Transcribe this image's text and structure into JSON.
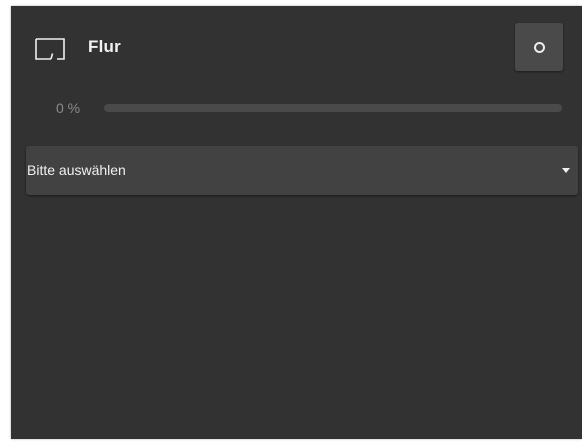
{
  "room": {
    "title": "Flur",
    "icon": "room-outline-icon"
  },
  "action_button": {
    "icon": "circle-icon"
  },
  "progress": {
    "label": "0 %",
    "value": 0
  },
  "select": {
    "selected": "Bitte auswählen",
    "caret_icon": "caret-down-icon"
  },
  "colors": {
    "panel": "#323232",
    "button": "#4a4a4a",
    "select": "#424242",
    "text": "#f2f2f2",
    "muted": "#8a8a8a"
  }
}
